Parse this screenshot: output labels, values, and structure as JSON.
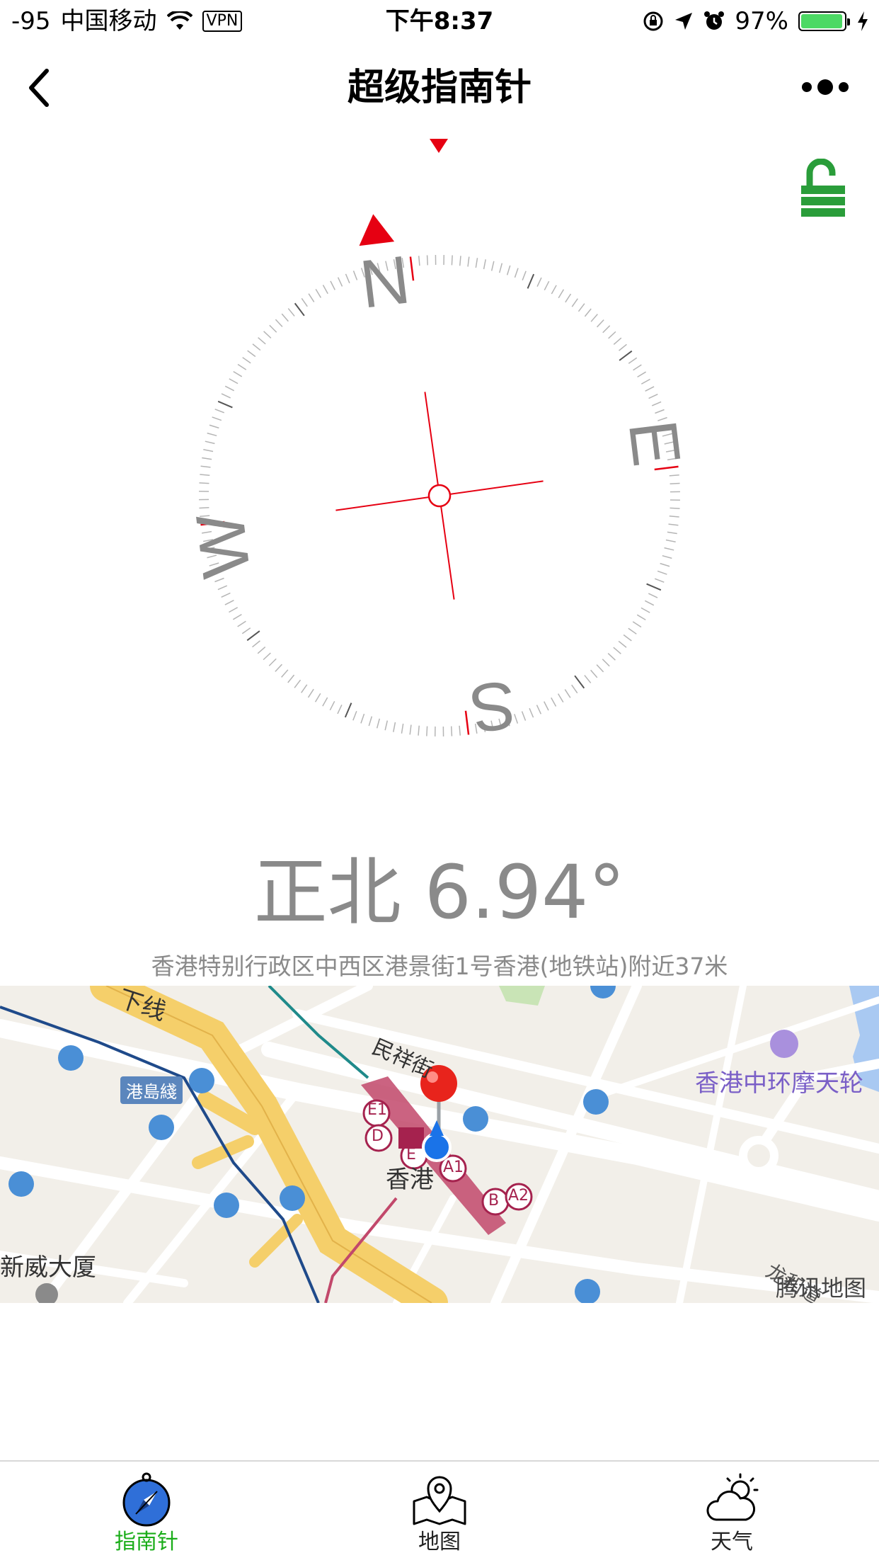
{
  "status_bar": {
    "signal": "-95",
    "carrier": "中国移动",
    "vpn": "VPN",
    "time": "下午8:37",
    "battery_pct": "97%",
    "battery_level": 0.97
  },
  "nav": {
    "title": "超级指南针"
  },
  "compass": {
    "n_label": "N",
    "e_label": "E",
    "s_label": "S",
    "w_label": "W",
    "rotation_deg": -6.94
  },
  "reading": {
    "heading_text": "正北 6.94°",
    "address": "香港特别行政区中西区港景街1号香港(地铁站)附近37米"
  },
  "map": {
    "labels": {
      "line_tag": "港島綫",
      "top_left_fragment": "下线",
      "street": "民祥街",
      "station": "香港",
      "poi": "香港中环摩天轮",
      "building": "新威大厦",
      "exit_e1": "E1",
      "exit_d": "D",
      "exit_e": "E",
      "exit_a1": "A1",
      "exit_b": "B",
      "exit_a2": "A2",
      "copyright": "腾讯地图",
      "road_fragment": "龙和道"
    }
  },
  "tabs": [
    {
      "label": "指南针",
      "active": true,
      "icon": "compass-icon"
    },
    {
      "label": "地图",
      "active": false,
      "icon": "map-icon"
    },
    {
      "label": "天气",
      "active": false,
      "icon": "weather-icon"
    }
  ],
  "colors": {
    "accent_green": "#1aad19",
    "compass_red": "#e60012",
    "label_gray": "#8a8a8a",
    "lock_green": "#2a9d3a"
  }
}
